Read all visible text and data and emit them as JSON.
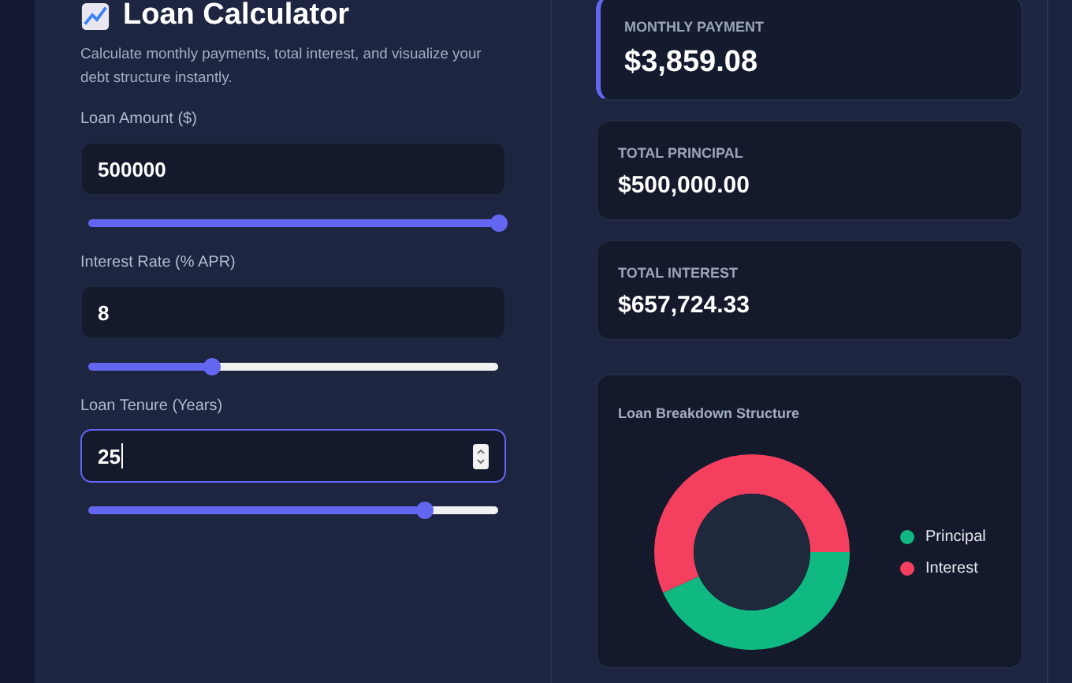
{
  "header": {
    "title": "Loan Calculator",
    "description": "Calculate monthly payments, total interest, and visualize your debt structure instantly."
  },
  "fields": [
    {
      "label": "Loan Amount ($)",
      "value": "500000",
      "focused": false,
      "level": 1.0
    },
    {
      "label": "Interest Rate (% APR)",
      "value": "8",
      "focused": false,
      "level": 0.3
    },
    {
      "label": "Loan Tenure (Years)",
      "value": "25",
      "focused": true,
      "level": 0.82
    }
  ],
  "results": [
    {
      "label": "MONTHLY PAYMENT",
      "value": "$3,859.08",
      "selected": true
    },
    {
      "label": "TOTAL PRINCIPAL",
      "value": "$500,000.00",
      "selected": false
    },
    {
      "label": "TOTAL INTEREST",
      "value": "$657,724.33",
      "selected": false
    }
  ],
  "breakdown": {
    "title": "Loan Breakdown Structure",
    "chart_data": {
      "type": "donut",
      "categories": [
        "Principal",
        "Interest"
      ],
      "values": [
        43.19,
        56.81
      ],
      "colors": [
        "#10b981",
        "#f43f5e"
      ],
      "legend": "right"
    }
  }
}
